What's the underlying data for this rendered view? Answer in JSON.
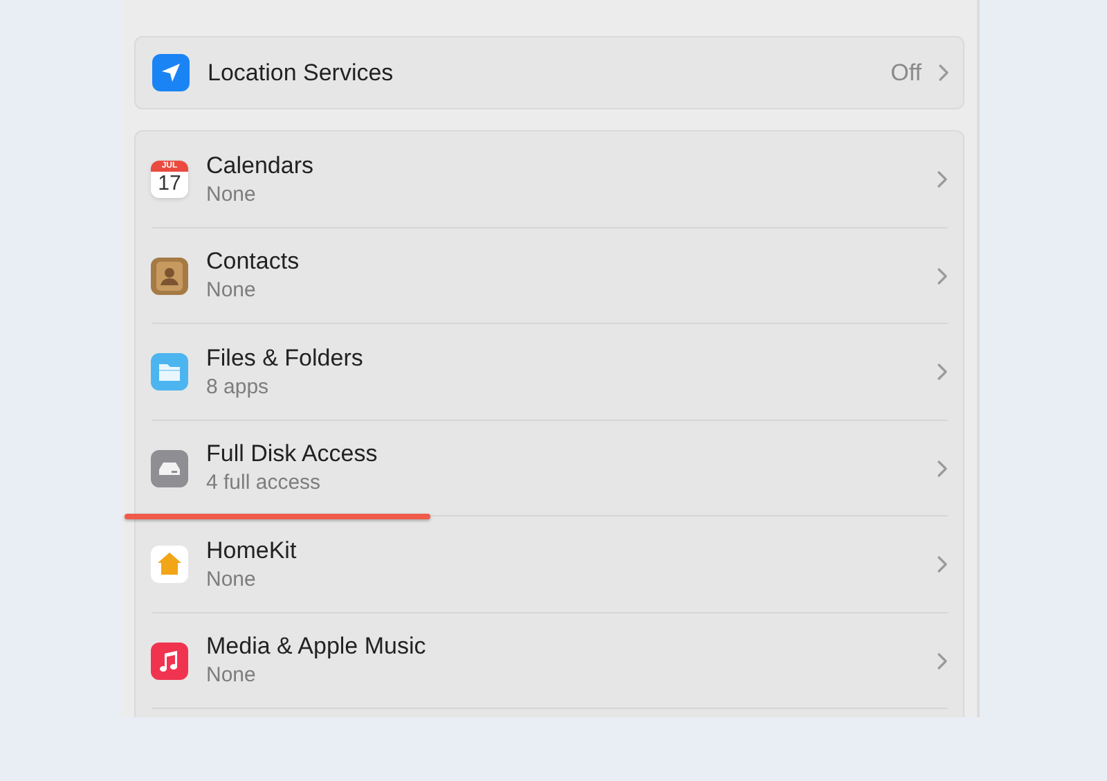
{
  "location_services": {
    "label": "Location Services",
    "value": "Off"
  },
  "items": [
    {
      "kind": "calendar",
      "label": "Calendars",
      "detail": "None",
      "icon_month": "JUL",
      "icon_day": "17",
      "underlined": false
    },
    {
      "kind": "contacts",
      "label": "Contacts",
      "detail": "None",
      "underlined": false
    },
    {
      "kind": "folder",
      "label": "Files & Folders",
      "detail": "8 apps",
      "underlined": false
    },
    {
      "kind": "disk",
      "label": "Full Disk Access",
      "detail": "4 full access",
      "underlined": true
    },
    {
      "kind": "home",
      "label": "HomeKit",
      "detail": "None",
      "underlined": false
    },
    {
      "kind": "music",
      "label": "Media & Apple Music",
      "detail": "None",
      "underlined": false
    }
  ]
}
